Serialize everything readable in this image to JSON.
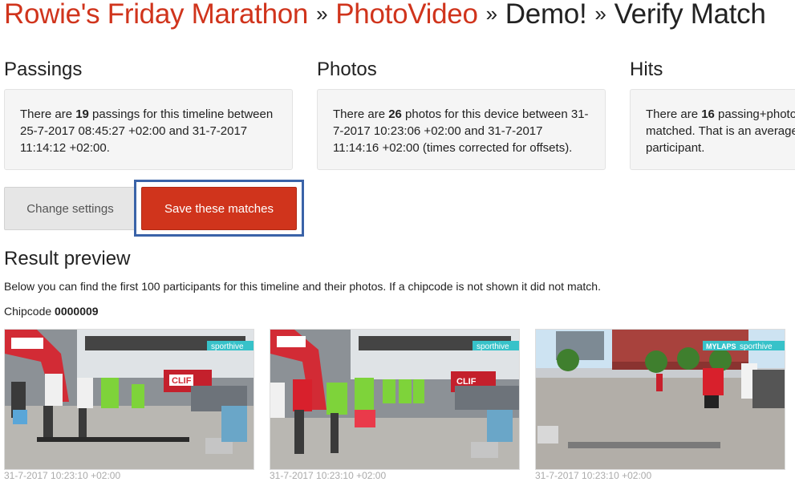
{
  "breadcrumb": {
    "items": [
      "Rowie's Friday Marathon",
      "PhotoVideo",
      "Demo!",
      "Verify Match"
    ],
    "separator": "»"
  },
  "passings": {
    "title": "Passings",
    "pre": "There are ",
    "count": "19",
    "post": " passings for this timeline between",
    "line2": "25-7-2017 08:45:27 +02:00 and 31-7-2017",
    "line3": "11:14:12 +02:00."
  },
  "photos": {
    "title": "Photos",
    "pre": "There are ",
    "count": "26",
    "post": " photos for this device between 31-",
    "line2": "7-2017 10:23:06 +02:00 and 31-7-2017",
    "line3": "11:14:16 +02:00 (times corrected for offsets)."
  },
  "hits": {
    "title": "Hits",
    "pre": "There are ",
    "count": "16",
    "post": " passing+photo",
    "line2": "matched. That is an average",
    "line3": "participant."
  },
  "buttons": {
    "change_settings": "Change settings",
    "save_matches": "Save these matches"
  },
  "result": {
    "title": "Result preview",
    "description": "Below you can find the first 100 participants for this timeline and their photos. If a chipcode is not shown it did not match.",
    "chipcode_label": "Chipcode ",
    "chipcode_value": "0000009"
  },
  "photos_list": [
    {
      "timestamp": "31-7-2017 10:23:10 +02:00",
      "sign": "sporthive",
      "logo": "CLIF"
    },
    {
      "timestamp": "31-7-2017 10:23:10 +02:00",
      "sign": "sporthive",
      "logo": "CLIF"
    },
    {
      "timestamp": "31-7-2017 10:23:10 +02:00",
      "sign": "sporthive",
      "brand": "MYLAPS"
    }
  ],
  "colors": {
    "accent": "#d0341c",
    "focus_outline": "#3a63a8",
    "panel_bg": "#f5f5f5"
  }
}
